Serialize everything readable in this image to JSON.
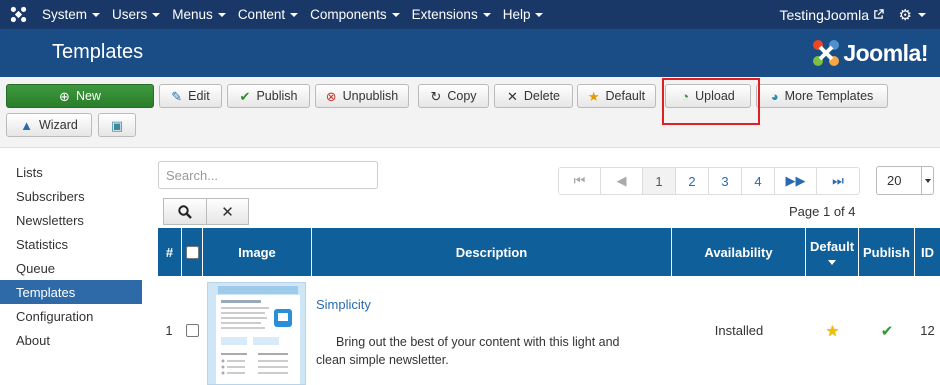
{
  "topnav": {
    "menu": [
      "System",
      "Users",
      "Menus",
      "Content",
      "Components",
      "Extensions",
      "Help"
    ],
    "site_name": "TestingJoomla"
  },
  "header": {
    "title": "Templates",
    "logo_text": "Joomla!"
  },
  "toolbar": {
    "new": "New",
    "edit": "Edit",
    "publish": "Publish",
    "unpublish": "Unpublish",
    "copy": "Copy",
    "delete": "Delete",
    "default": "Default",
    "upload": "Upload",
    "more_templates": "More Templates",
    "wizard": "Wizard"
  },
  "sidebar": {
    "items": [
      "Lists",
      "Subscribers",
      "Newsletters",
      "Statistics",
      "Queue",
      "Templates",
      "Configuration",
      "About"
    ]
  },
  "search": {
    "placeholder": "Search..."
  },
  "pagination": {
    "pages": [
      "1",
      "2",
      "3",
      "4"
    ],
    "summary": "Page 1 of 4",
    "limit": "20"
  },
  "table": {
    "headers": {
      "num": "#",
      "image": "Image",
      "description": "Description",
      "availability": "Availability",
      "default": "Default",
      "publish": "Publish",
      "id": "ID"
    },
    "rows": [
      {
        "num": "1",
        "title": "Simplicity",
        "description": "Bring out the best of your content with this light and clean simple newsletter.",
        "availability": "Installed",
        "id": "12"
      }
    ]
  },
  "colors": {
    "topnav": "#1a3867",
    "header": "#1a4c85",
    "table_header": "#0f5f9a",
    "new_button": "#2b7d2b",
    "highlight": "#e02020"
  }
}
